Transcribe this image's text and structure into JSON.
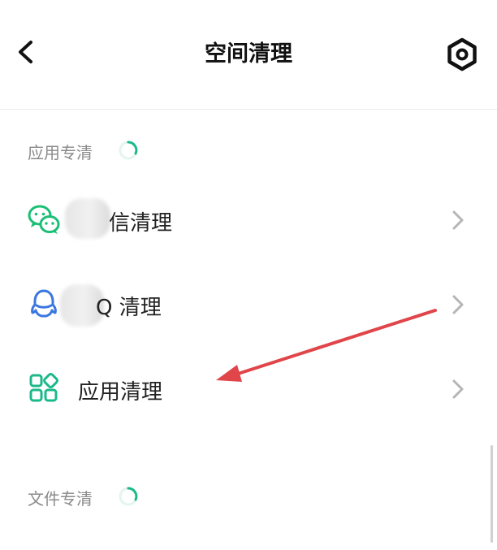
{
  "header": {
    "title": "空间清理",
    "back_icon": "chevron-left-icon",
    "settings_icon": "hexagon-gear-icon"
  },
  "sections": [
    {
      "label": "应用专清",
      "items": [
        {
          "label": "信清理",
          "icon": "wechat-icon",
          "color": "#1bbf75"
        },
        {
          "label": "Q 清理",
          "icon": "qq-penguin-icon",
          "color": "#3b76e0"
        },
        {
          "label": "应用清理",
          "icon": "apps-grid-icon",
          "color": "#1bb98a"
        }
      ]
    },
    {
      "label": "文件专清",
      "items": []
    }
  ],
  "colors": {
    "accent": "#1bb98a",
    "annotation_arrow": "#e0454a"
  }
}
